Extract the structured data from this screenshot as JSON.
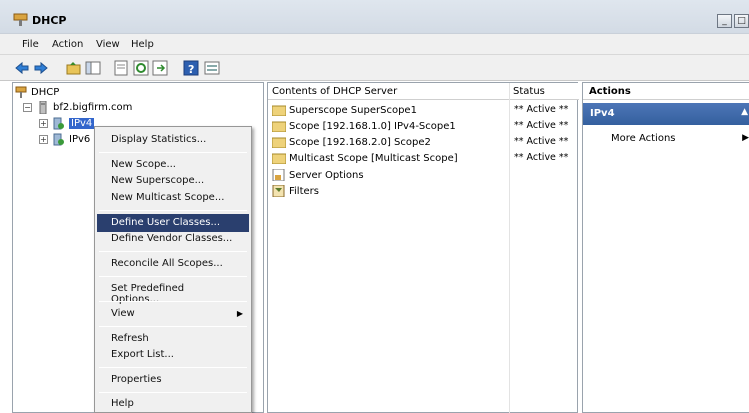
{
  "window": {
    "title": "DHCP",
    "controls": [
      "_",
      "□"
    ]
  },
  "menu": [
    "File",
    "Action",
    "View",
    "Help"
  ],
  "tree": {
    "root": "DHCP",
    "server": "bf2.bigfirm.com",
    "ipv4": "IPv4",
    "ipv6": "IPv6"
  },
  "content": {
    "col_name": "Contents of DHCP Server",
    "col_status": "Status",
    "rows": [
      {
        "name": "Superscope SuperScope1",
        "status": "** Active **"
      },
      {
        "name": "Scope [192.168.1.0] IPv4-Scope1",
        "status": "** Active **"
      },
      {
        "name": "Scope [192.168.2.0] Scope2",
        "status": "** Active **"
      },
      {
        "name": "Multicast Scope [Multicast Scope]",
        "status": "** Active **"
      },
      {
        "name": "Server Options",
        "status": ""
      },
      {
        "name": "Filters",
        "status": ""
      }
    ]
  },
  "actions": {
    "header": "Actions",
    "section": "IPv4",
    "more": "More Actions"
  },
  "context_menu": {
    "items": [
      "Display Statistics...",
      "New Scope...",
      "New Superscope...",
      "New Multicast Scope...",
      "Define User Classes...",
      "Define Vendor Classes...",
      "Reconcile All Scopes...",
      "Set Predefined Options...",
      "View",
      "Refresh",
      "Export List...",
      "Properties",
      "Help"
    ],
    "highlighted": "Define User Classes..."
  },
  "colors": {
    "selection": "#3366cc",
    "menu_highlight": "#2a3f6e",
    "action_band": "#3d68aa"
  }
}
